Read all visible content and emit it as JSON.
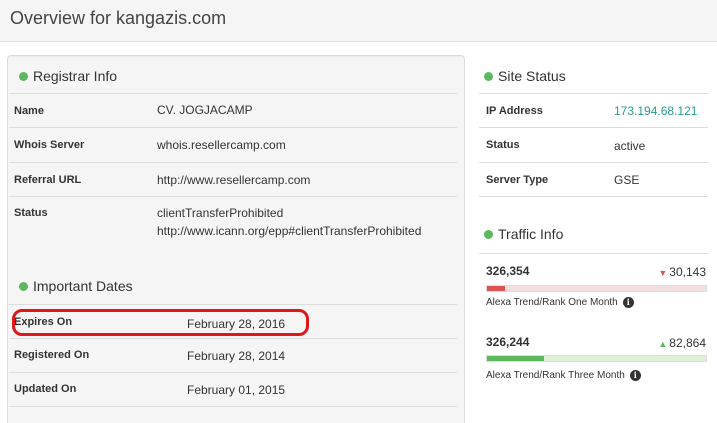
{
  "page": {
    "title": "Overview for kangazis.com"
  },
  "registrar": {
    "title": "Registrar Info",
    "rows": [
      {
        "key": "Name",
        "value": "CV. JOGJACAMP"
      },
      {
        "key": "Whois Server",
        "value": "whois.resellercamp.com"
      },
      {
        "key": "Referral URL",
        "value": "http://www.resellercamp.com"
      },
      {
        "key": "Status",
        "value": "clientTransferProhibited",
        "value2": "http://www.icann.org/epp#clientTransferProhibited"
      }
    ]
  },
  "dates": {
    "title": "Important Dates",
    "rows": [
      {
        "key": "Expires On",
        "value": "February 28, 2016"
      },
      {
        "key": "Registered On",
        "value": "February 28, 2014"
      },
      {
        "key": "Updated On",
        "value": "February 01, 2015"
      }
    ]
  },
  "site_status": {
    "title": "Site Status",
    "rows": [
      {
        "key": "IP Address",
        "value": "173.194.68.121"
      },
      {
        "key": "Status",
        "value": "active"
      },
      {
        "key": "Server Type",
        "value": "GSE"
      }
    ]
  },
  "traffic": {
    "title": "Traffic Info",
    "items": [
      {
        "rank": "326,354",
        "delta": "30,143",
        "direction": "down",
        "fill_fraction": 0.08,
        "fill_color": "#d9534f",
        "caption": "Alexa Trend/Rank One Month"
      },
      {
        "rank": "326,244",
        "delta": "82,864",
        "direction": "up",
        "fill_fraction": 0.26,
        "fill_color": "#5cb85c",
        "caption": "Alexa Trend/Rank Three Month"
      }
    ],
    "info_icon_glyph": "i"
  },
  "colors": {
    "accent_green": "#5cb85c",
    "link_teal": "#2a9d8f",
    "highlight_red": "#e0161b"
  }
}
